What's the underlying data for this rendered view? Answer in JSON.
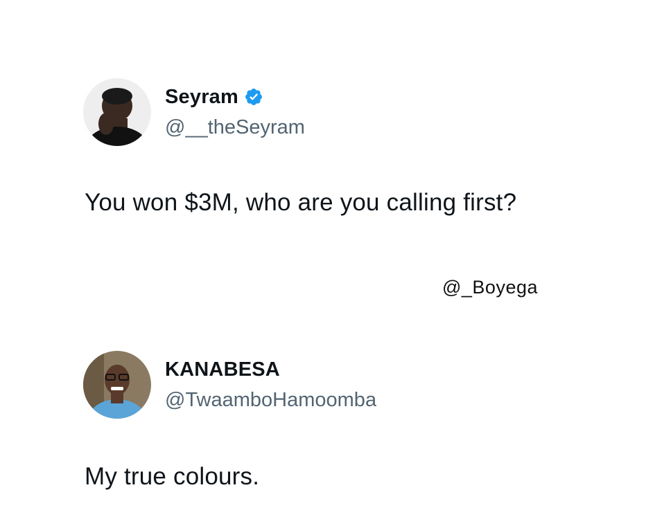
{
  "tweets": [
    {
      "display_name": "Seyram",
      "handle": "@__theSeyram",
      "verified": true,
      "avatar_icon": "avatar-photo-seyram",
      "text": "You won $3M, who are you calling first?"
    },
    {
      "display_name": "KANABESA",
      "handle": "@TwaamboHamoomba",
      "verified": false,
      "avatar_icon": "avatar-photo-kanabesa",
      "text": "My true colours."
    }
  ],
  "watermark": "@_Boyega",
  "colors": {
    "background": "#ffffff",
    "text": "#0f1419",
    "handle": "#536471",
    "verified_badge": "#1d9bf0"
  }
}
